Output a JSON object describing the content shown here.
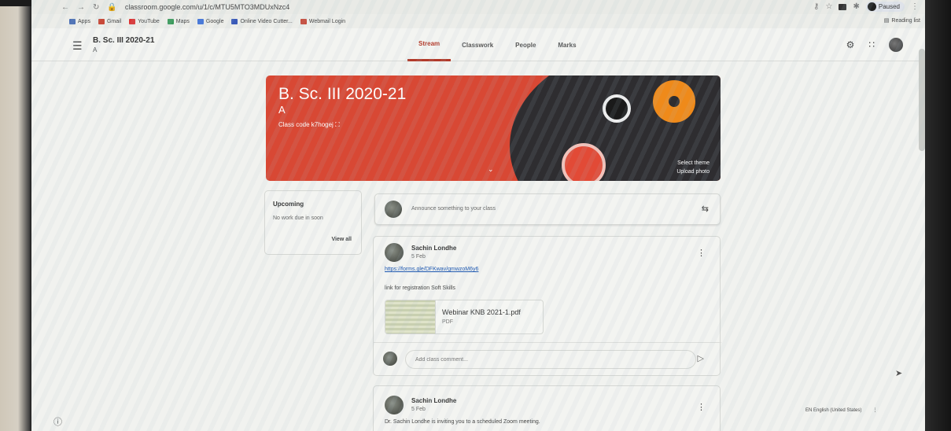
{
  "browser": {
    "url": "classroom.google.com/u/1/c/MTU5MTO3MDUxNzc4",
    "profile_label": "Paused",
    "reading_list": "Reading list",
    "bookmarks": [
      {
        "label": "Apps",
        "color": "#4a6fb5"
      },
      {
        "label": "Gmail",
        "color": "#c84a3a"
      },
      {
        "label": "YouTube",
        "color": "#d33"
      },
      {
        "label": "Maps",
        "color": "#3a9a5a"
      },
      {
        "label": "Google",
        "color": "#4a7ad8"
      },
      {
        "label": "Online Video Cutter...",
        "color": "#3a5ab8"
      },
      {
        "label": "Webmail Login",
        "color": "#c84a3a"
      }
    ]
  },
  "header": {
    "class_name": "B. Sc. III 2020-21",
    "section": "A",
    "tabs": [
      {
        "label": "Stream",
        "active": true
      },
      {
        "label": "Classwork",
        "active": false
      },
      {
        "label": "People",
        "active": false
      },
      {
        "label": "Marks",
        "active": false
      }
    ]
  },
  "banner": {
    "title": "B. Sc. III 2020-21",
    "section": "A",
    "class_code": "Class code  k7hogej",
    "select_theme": "Select theme",
    "upload_photo": "Upload photo",
    "color": "#d84834"
  },
  "upcoming": {
    "heading": "Upcoming",
    "text": "No work due in soon",
    "view_all": "View all"
  },
  "announce": {
    "placeholder": "Announce something to your class"
  },
  "posts": [
    {
      "author": "Sachin Londhe",
      "date": "5 Feb",
      "link": "https://forms.gle/DFKwav/gmwzoM6y6",
      "body": "link for registration Soft Skills",
      "attachment": {
        "name": "Webinar KNB 2021-1.pdf",
        "type": "PDF"
      },
      "comment_placeholder": "Add class comment..."
    },
    {
      "author": "Sachin Londhe",
      "date": "5 Feb",
      "body": "Dr. Sachin Londhe is inviting you to a scheduled Zoom meeting."
    }
  ],
  "footer": {
    "language": "EN English (United States)"
  }
}
